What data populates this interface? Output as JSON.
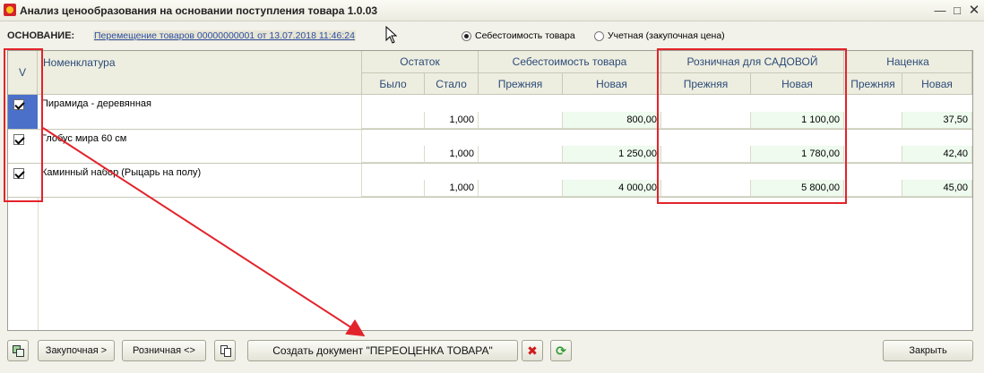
{
  "window": {
    "title": "Анализ ценообразования на основании поступления товара 1.0.03"
  },
  "header": {
    "osnov_label": "ОСНОВАНИЕ:",
    "osnov_link": "Перемещение товаров 00000000001 от 13.07.2018 11:46:24",
    "radio_cost": "Себестоимость товара",
    "radio_account": "Учетная (закупочная цена)",
    "selected_radio": "radio_cost"
  },
  "table": {
    "col_check": "V",
    "col_name": "Номенклатура",
    "groups": {
      "stock": "Остаток",
      "cost": "Себестоимость товара",
      "retail": "Розничная для САДОВОЙ",
      "markup": "Наценка"
    },
    "sub": {
      "was": "Было",
      "became": "Стало",
      "prev": "Прежняя",
      "new": "Новая"
    },
    "rows": [
      {
        "name": "Пирамида - деревянная",
        "checked": true,
        "stock_was": "",
        "stock_became": "1,000",
        "cost_prev": "",
        "cost_new": "800,00",
        "retail_prev": "",
        "retail_new": "1 100,00",
        "markup_prev": "",
        "markup_new": "37,50"
      },
      {
        "name": "Глобус мира 60 см",
        "checked": true,
        "stock_was": "",
        "stock_became": "1,000",
        "cost_prev": "",
        "cost_new": "1 250,00",
        "retail_prev": "",
        "retail_new": "1 780,00",
        "markup_prev": "",
        "markup_new": "42,40"
      },
      {
        "name": "Каминный набор (Рыцарь на полу)",
        "checked": true,
        "stock_was": "",
        "stock_became": "1,000",
        "cost_prev": "",
        "cost_new": "4 000,00",
        "retail_prev": "",
        "retail_new": "5 800,00",
        "markup_prev": "",
        "markup_new": "45,00"
      }
    ]
  },
  "toolbar": {
    "purchase": "Закупочная >",
    "retail": "Розничная <>",
    "create_doc": "Создать документ \"ПЕРЕОЦЕНКА ТОВАРА\"",
    "close": "Закрыть"
  },
  "colors": {
    "annotation": "#e3232b",
    "header_text": "#2d4a78",
    "new_value_bg": "#eefbee",
    "selected_row": "#4b70c9"
  }
}
